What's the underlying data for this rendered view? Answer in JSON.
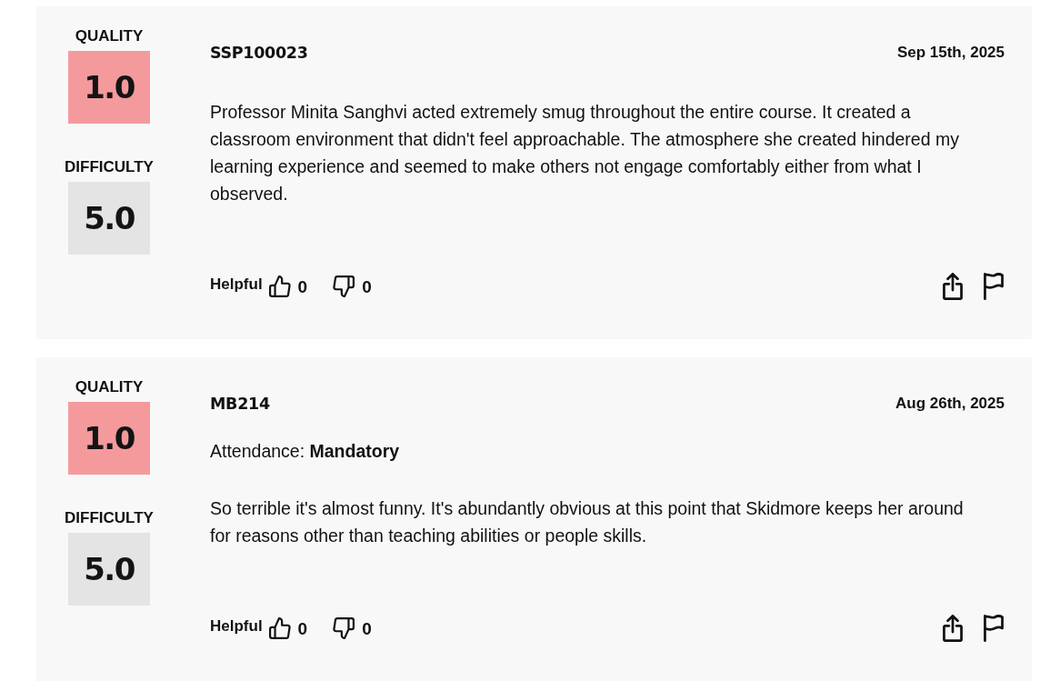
{
  "reviews": [
    {
      "ratings": [
        {
          "label": "QUALITY",
          "value": "1.0",
          "color": "#f49a9c"
        },
        {
          "label": "DIFFICULTY",
          "value": "5.0",
          "color": "#e4e4e4"
        }
      ],
      "course": "SSP100023",
      "date": "Sep 15th, 2025",
      "comment": "Professor Minita Sanghvi acted extremely smug throughout the entire course. It created a classroom environment that didn't feel approachable. The atmosphere she created hindered my learning experience and seemed to make others not engage comfortably either from what I observed.",
      "helpful_label": "Helpful",
      "thumbs_up": "0",
      "thumbs_down": "0"
    },
    {
      "ratings": [
        {
          "label": "QUALITY",
          "value": "1.0",
          "color": "#f49a9c"
        },
        {
          "label": "DIFFICULTY",
          "value": "5.0",
          "color": "#e4e4e4"
        }
      ],
      "course": "MB214",
      "date": "Aug 26th, 2025",
      "details": [
        "Attendance: **Mandatory**"
      ],
      "comment": "So terrible it's almost funny. It's abundantly obvious at this point that Skidmore keeps her around for reasons other than teaching abilities or people skills.",
      "helpful_label": "Helpful",
      "thumbs_up": "0",
      "thumbs_down": "0"
    }
  ]
}
